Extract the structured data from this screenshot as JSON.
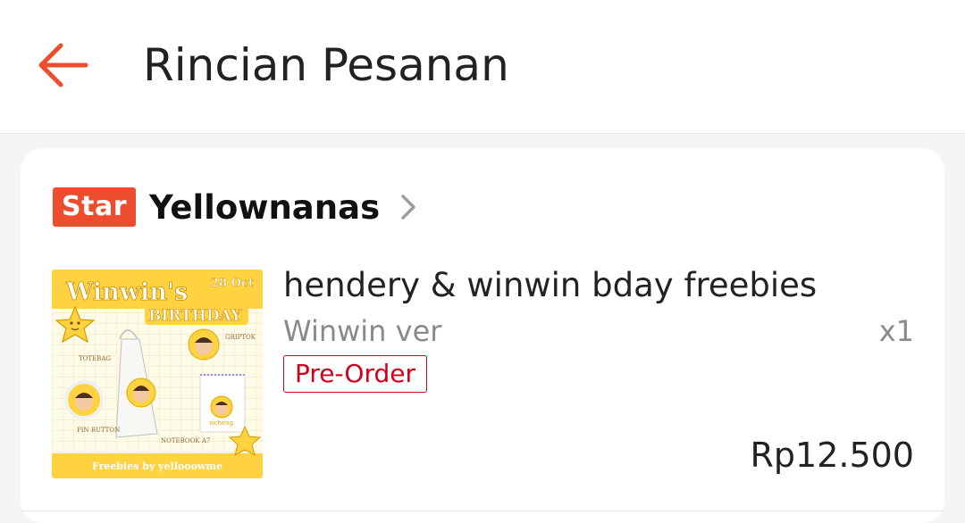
{
  "header": {
    "title": "Rincian Pesanan",
    "back_icon": "arrow-left-icon",
    "accent_color": "#ee4d2d"
  },
  "shop": {
    "badge": "Star",
    "name": "Yellownanas",
    "chevron_icon": "chevron-right-icon"
  },
  "product": {
    "name": "hendery & winwin bday freebies",
    "variant": "Winwin ver",
    "quantity": "x1",
    "tag": "Pre-Order",
    "price": "Rp12.500",
    "thumbnail": {
      "title_line1": "Winwin's",
      "title_line2": "BIRTHDAY",
      "date": "28 Oct",
      "label_griptok": "GRIPTOK",
      "label_totebag": "TOTEBAG",
      "label_pin": "PIN BUTTON",
      "label_notebook": "NOTEBOOK A7",
      "label_sicheng": "sicheng",
      "footer": "Freebies by yellooowme"
    }
  }
}
